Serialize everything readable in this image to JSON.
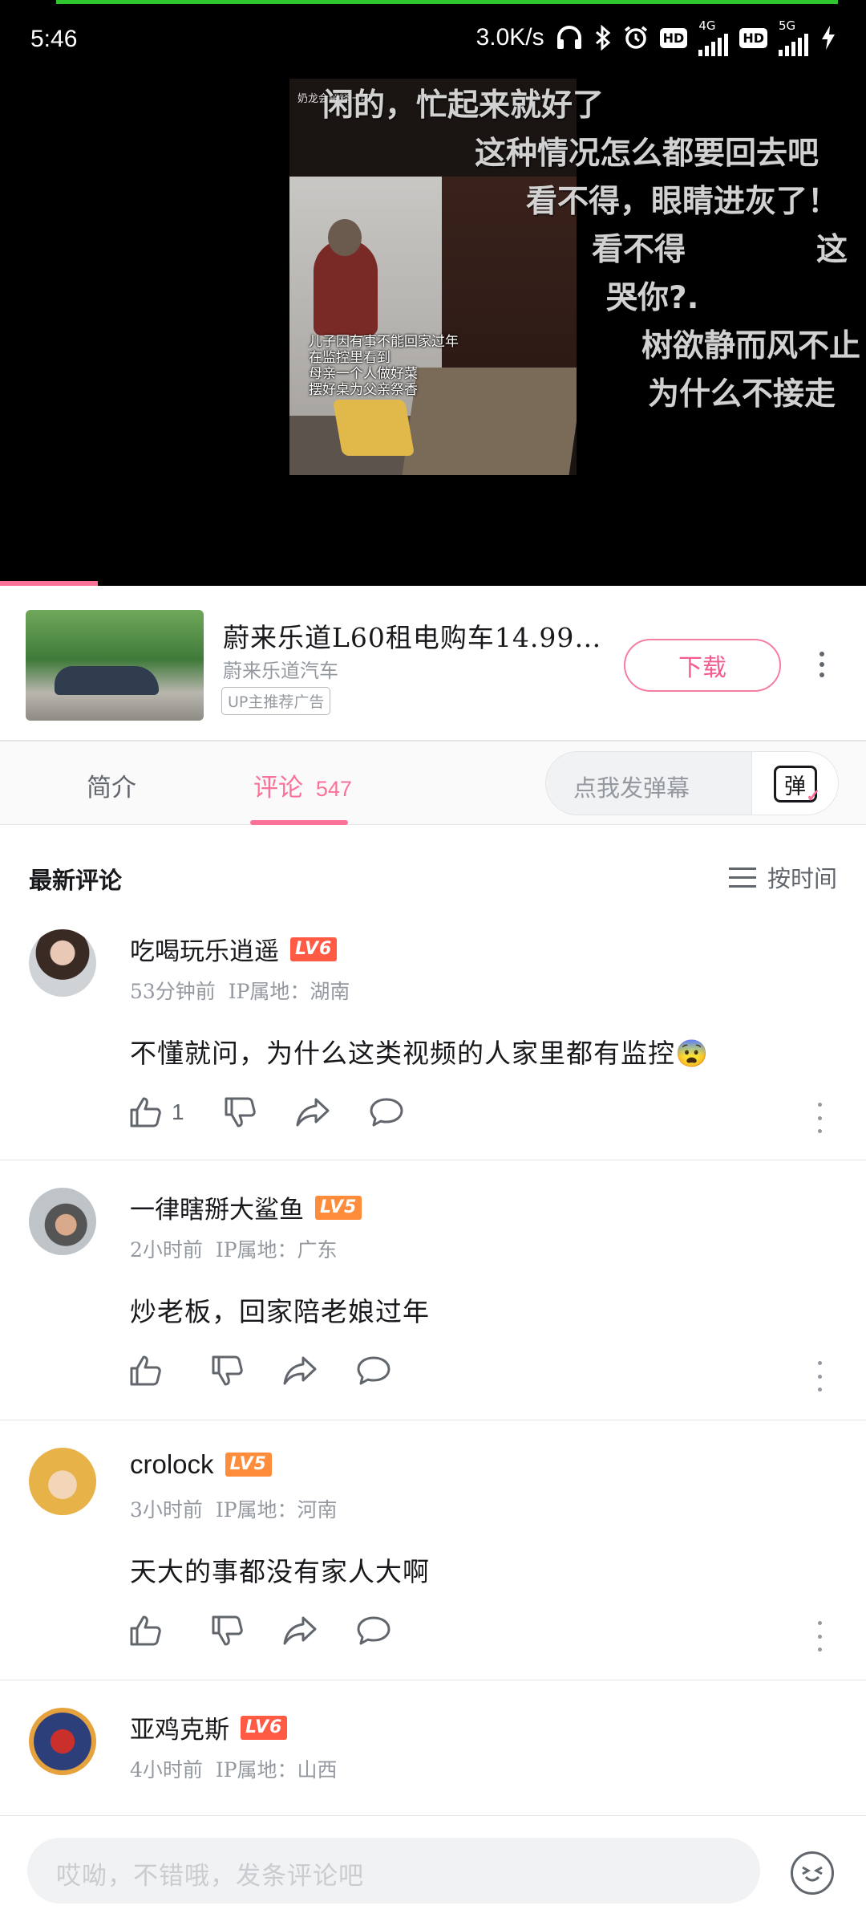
{
  "status_bar": {
    "time": "5:46",
    "net_speed": "3.0K/s",
    "sim1_type": "4G",
    "sim2_type": "5G",
    "hd_label": "HD"
  },
  "video": {
    "logo_text": "奶龙会解释一切",
    "caption": [
      "儿子因有事不能回家过年",
      "在监控里看到",
      "母亲一个人做好菜",
      "摆好桌为父亲祭香"
    ],
    "danmaku": [
      "闲的，忙起来就好了",
      "这种情况怎么都要回去吧",
      "看不得，眼睛进灰了！",
      "看不得",
      "这",
      "哭你?.",
      "树欲静而风不止",
      "为什么不接走"
    ]
  },
  "ad": {
    "title": "蔚来乐道L60租电购车14.99…",
    "advertiser": "蔚来乐道汽车",
    "badge": "UP主推荐广告",
    "download_label": "下载"
  },
  "tabs": {
    "intro_label": "简介",
    "comments_label": "评论",
    "comments_count": "547",
    "danmaku_placeholder": "点我发弹幕",
    "danmaku_button": "弹"
  },
  "comments_header": {
    "title": "最新评论",
    "sort_label": "按时间"
  },
  "comments": [
    {
      "user": "吃喝玩乐逍遥",
      "level": "LV6",
      "time": "53分钟前",
      "ip": "IP属地：湖南",
      "text": "不懂就问，为什么这类视频的人家里都有监控😨",
      "likes": "1"
    },
    {
      "user": "一律瞎掰大鲨鱼",
      "level": "LV5",
      "time": "2小时前",
      "ip": "IP属地：广东",
      "text": "炒老板，回家陪老娘过年",
      "likes": ""
    },
    {
      "user": "crolock",
      "level": "LV5",
      "time": "3小时前",
      "ip": "IP属地：河南",
      "text": "天大的事都没有家人大啊",
      "likes": ""
    },
    {
      "user": "亚鸡克斯",
      "level": "LV6",
      "time": "4小时前",
      "ip": "IP属地：山西",
      "text": "",
      "likes": ""
    }
  ],
  "bottom_bar": {
    "reply_placeholder": "哎呦，不错哦，发条评论吧"
  },
  "colors": {
    "accent_pink": "#fb7299",
    "lv6": "#ff5a43",
    "lv5": "#ff8c3a",
    "top_progress": "#2ec62e"
  }
}
